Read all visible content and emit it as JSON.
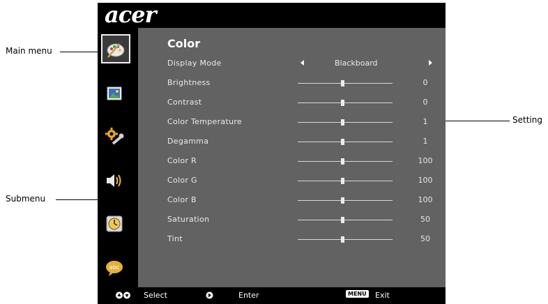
{
  "callouts": {
    "main_menu": "Main menu",
    "submenu": "Submenu",
    "setting": "Setting"
  },
  "osd": {
    "brand": "acer",
    "title": "Color",
    "menu_icons": [
      "color-palette-icon",
      "image-icon",
      "settings-wrench-icon",
      "speaker-icon",
      "clock-icon",
      "language-icon"
    ],
    "display_mode": {
      "label": "Display Mode",
      "value": "Blackboard"
    },
    "rows": [
      {
        "label": "Brightness",
        "value": "0"
      },
      {
        "label": "Contrast",
        "value": "0"
      },
      {
        "label": "Color Temperature",
        "value": "1"
      },
      {
        "label": "Degamma",
        "value": "1"
      },
      {
        "label": "Color R",
        "value": "100"
      },
      {
        "label": "Color G",
        "value": "100"
      },
      {
        "label": "Color B",
        "value": "100"
      },
      {
        "label": "Saturation",
        "value": "50"
      },
      {
        "label": "Tint",
        "value": "50"
      }
    ],
    "footer": {
      "select": "Select",
      "enter": "Enter",
      "menu_key": "MENU",
      "exit": "Exit"
    }
  }
}
